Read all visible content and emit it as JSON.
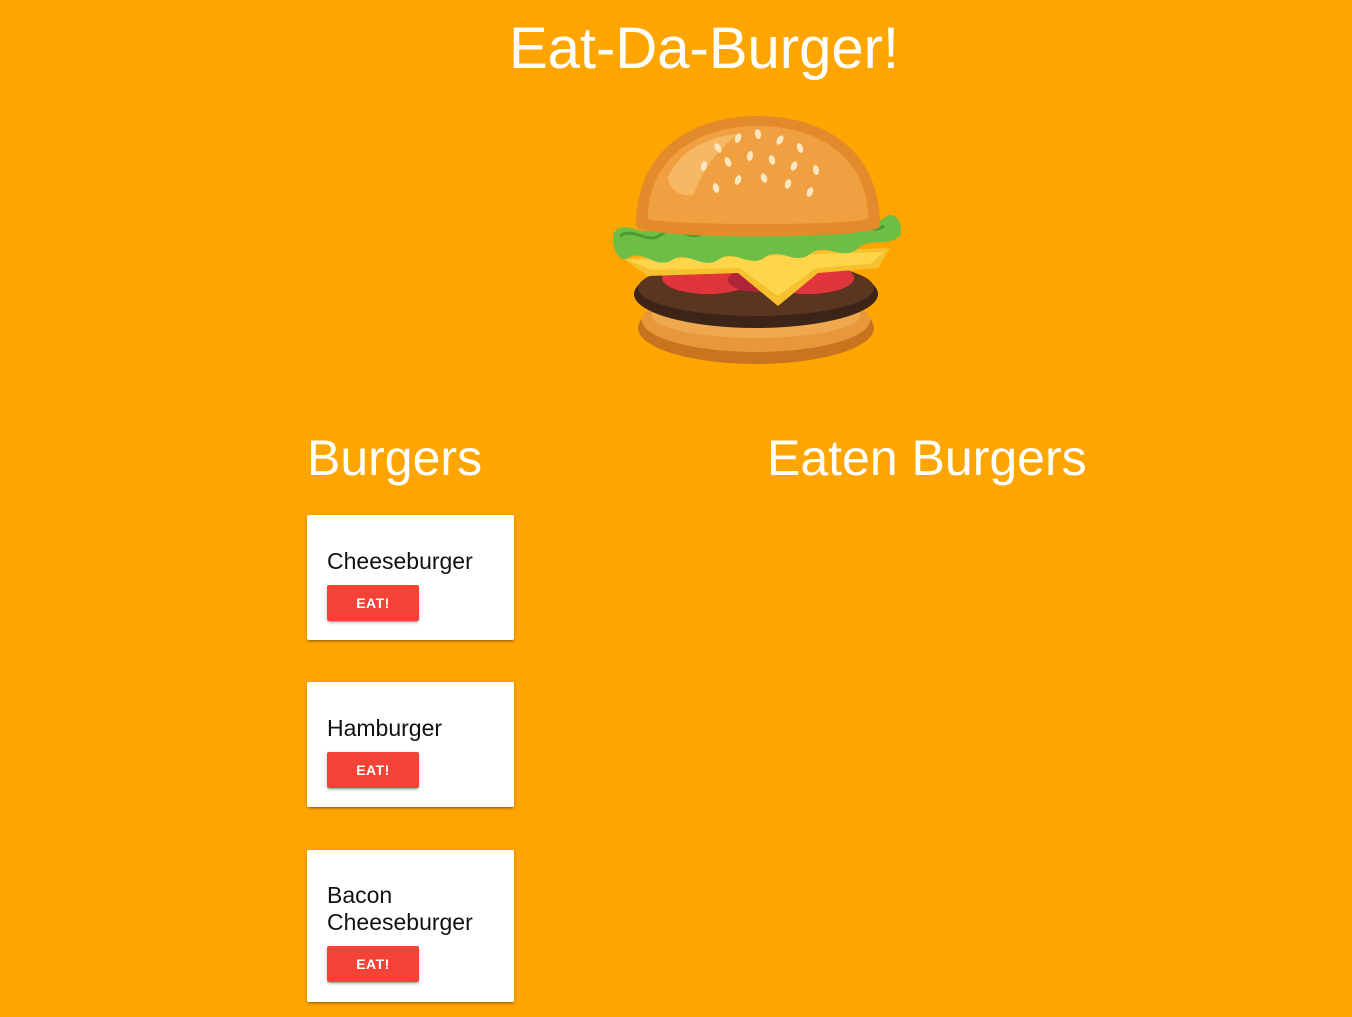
{
  "page": {
    "title": "Eat-Da-Burger!",
    "hero_image": "burger-illustration"
  },
  "columns": {
    "uneaten_heading": "Burgers",
    "eaten_heading": "Eaten Burgers"
  },
  "burgers": [
    {
      "name": "Cheeseburger",
      "button_label": "EAT!"
    },
    {
      "name": "Hamburger",
      "button_label": "EAT!"
    },
    {
      "name": "Bacon Cheeseburger",
      "button_label": "EAT!"
    }
  ],
  "eaten_burgers": [],
  "colors": {
    "background": "#FFA500",
    "card": "#FFFFFF",
    "button": "#F44336",
    "heading_text": "#FFFFFF"
  }
}
